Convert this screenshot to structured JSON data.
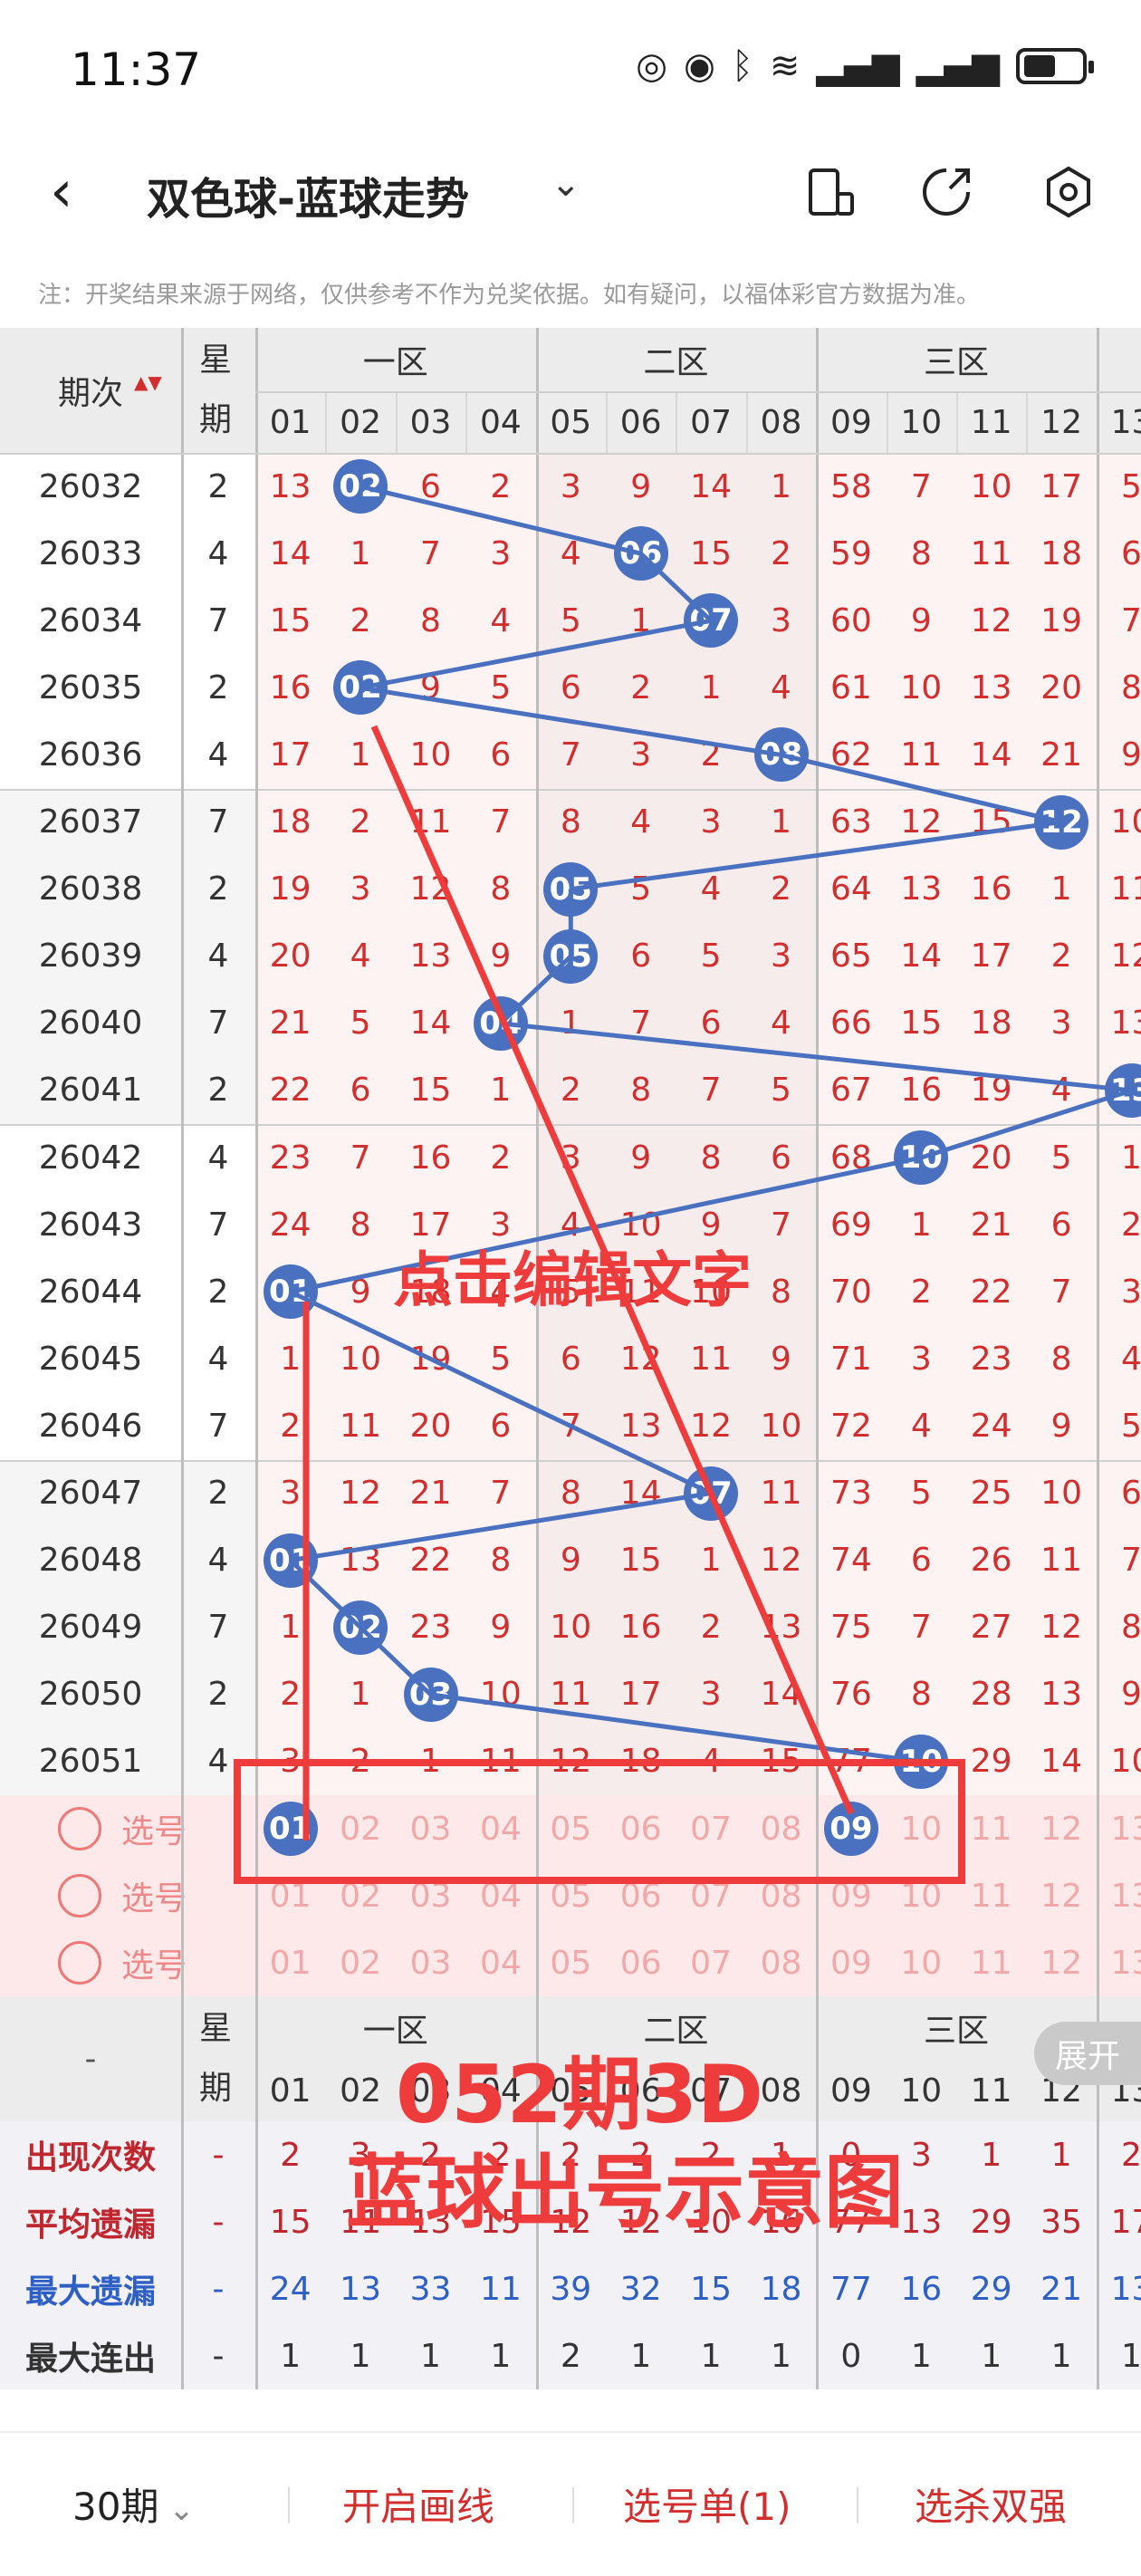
{
  "status": {
    "time": "11:37"
  },
  "header": {
    "title": "双色球-蓝球走势"
  },
  "notice": "注：开奖结果来源于网络，仅供参考不作为兑奖依据。如有疑问，以福体彩官方数据为准。",
  "table": {
    "col_issue": "期次",
    "col_week": "星期",
    "zones": [
      "一区",
      "二区",
      "三区"
    ],
    "cols": [
      "01",
      "02",
      "03",
      "04",
      "05",
      "06",
      "07",
      "08",
      "09",
      "10",
      "11",
      "12",
      "13"
    ],
    "rows": [
      {
        "issue": "26032",
        "week": "2",
        "vals": [
          "13",
          "02",
          "6",
          "2",
          "3",
          "9",
          "14",
          "1",
          "58",
          "7",
          "10",
          "17",
          "5"
        ],
        "hit": 1
      },
      {
        "issue": "26033",
        "week": "4",
        "vals": [
          "14",
          "1",
          "7",
          "3",
          "4",
          "06",
          "15",
          "2",
          "59",
          "8",
          "11",
          "18",
          "6"
        ],
        "hit": 5
      },
      {
        "issue": "26034",
        "week": "7",
        "vals": [
          "15",
          "2",
          "8",
          "4",
          "5",
          "1",
          "07",
          "3",
          "60",
          "9",
          "12",
          "19",
          "7"
        ],
        "hit": 6
      },
      {
        "issue": "26035",
        "week": "2",
        "vals": [
          "16",
          "02",
          "9",
          "5",
          "6",
          "2",
          "1",
          "4",
          "61",
          "10",
          "13",
          "20",
          "8"
        ],
        "hit": 1
      },
      {
        "issue": "26036",
        "week": "4",
        "vals": [
          "17",
          "1",
          "10",
          "6",
          "7",
          "3",
          "2",
          "08",
          "62",
          "11",
          "14",
          "21",
          "9"
        ],
        "hit": 7
      },
      {
        "issue": "26037",
        "week": "7",
        "vals": [
          "18",
          "2",
          "11",
          "7",
          "8",
          "4",
          "3",
          "1",
          "63",
          "12",
          "15",
          "12",
          "10"
        ],
        "hit": 11
      },
      {
        "issue": "26038",
        "week": "2",
        "vals": [
          "19",
          "3",
          "12",
          "8",
          "05",
          "5",
          "4",
          "2",
          "64",
          "13",
          "16",
          "1",
          "11"
        ],
        "hit": 4
      },
      {
        "issue": "26039",
        "week": "4",
        "vals": [
          "20",
          "4",
          "13",
          "9",
          "05",
          "6",
          "5",
          "3",
          "65",
          "14",
          "17",
          "2",
          "12"
        ],
        "hit": 4
      },
      {
        "issue": "26040",
        "week": "7",
        "vals": [
          "21",
          "5",
          "14",
          "04",
          "1",
          "7",
          "6",
          "4",
          "66",
          "15",
          "18",
          "3",
          "13"
        ],
        "hit": 3
      },
      {
        "issue": "26041",
        "week": "2",
        "vals": [
          "22",
          "6",
          "15",
          "1",
          "2",
          "8",
          "7",
          "5",
          "67",
          "16",
          "19",
          "4",
          "13"
        ],
        "hit": 12
      },
      {
        "issue": "26042",
        "week": "4",
        "vals": [
          "23",
          "7",
          "16",
          "2",
          "3",
          "9",
          "8",
          "6",
          "68",
          "10",
          "20",
          "5",
          "1"
        ],
        "hit": 9
      },
      {
        "issue": "26043",
        "week": "7",
        "vals": [
          "24",
          "8",
          "17",
          "3",
          "4",
          "10",
          "9",
          "7",
          "69",
          "1",
          "21",
          "6",
          "2"
        ],
        "hit": -1
      },
      {
        "issue": "26044",
        "week": "2",
        "vals": [
          "01",
          "9",
          "18",
          "4",
          "5",
          "11",
          "10",
          "8",
          "70",
          "2",
          "22",
          "7",
          "3"
        ],
        "hit": 0
      },
      {
        "issue": "26045",
        "week": "4",
        "vals": [
          "1",
          "10",
          "19",
          "5",
          "6",
          "12",
          "11",
          "9",
          "71",
          "3",
          "23",
          "8",
          "4"
        ],
        "hit": -1
      },
      {
        "issue": "26046",
        "week": "7",
        "vals": [
          "2",
          "11",
          "20",
          "6",
          "7",
          "13",
          "12",
          "10",
          "72",
          "4",
          "24",
          "9",
          "5"
        ],
        "hit": -1
      },
      {
        "issue": "26047",
        "week": "2",
        "vals": [
          "3",
          "12",
          "21",
          "7",
          "8",
          "14",
          "07",
          "11",
          "73",
          "5",
          "25",
          "10",
          "6"
        ],
        "hit": 6
      },
      {
        "issue": "26048",
        "week": "4",
        "vals": [
          "01",
          "13",
          "22",
          "8",
          "9",
          "15",
          "1",
          "12",
          "74",
          "6",
          "26",
          "11",
          "7"
        ],
        "hit": 0
      },
      {
        "issue": "26049",
        "week": "7",
        "vals": [
          "1",
          "02",
          "23",
          "9",
          "10",
          "16",
          "2",
          "13",
          "75",
          "7",
          "27",
          "12",
          "8"
        ],
        "hit": 1
      },
      {
        "issue": "26050",
        "week": "2",
        "vals": [
          "2",
          "1",
          "03",
          "10",
          "11",
          "17",
          "3",
          "14",
          "76",
          "8",
          "28",
          "13",
          "9"
        ],
        "hit": 2
      },
      {
        "issue": "26051",
        "week": "4",
        "vals": [
          "3",
          "2",
          "1",
          "11",
          "12",
          "18",
          "4",
          "15",
          "77",
          "10",
          "29",
          "14",
          "10"
        ],
        "hit": 9
      }
    ],
    "pick_label": "选号",
    "pick_rows": 3,
    "pick_selected": [
      0,
      8
    ],
    "stats": [
      {
        "label": "出现次数",
        "week": "-",
        "vals": [
          "2",
          "3",
          "2",
          "2",
          "2",
          "2",
          "2",
          "1",
          "0",
          "3",
          "1",
          "1",
          "2"
        ],
        "color": "#c0262e"
      },
      {
        "label": "平均遗漏",
        "week": "-",
        "vals": [
          "15",
          "11",
          "13",
          "15",
          "12",
          "12",
          "10",
          "16",
          "77",
          "13",
          "29",
          "35",
          "17"
        ],
        "color": "#c0262e"
      },
      {
        "label": "最大遗漏",
        "week": "-",
        "vals": [
          "24",
          "13",
          "33",
          "11",
          "39",
          "32",
          "15",
          "18",
          "77",
          "16",
          "29",
          "21",
          "13"
        ],
        "color": "#2d5fc4"
      },
      {
        "label": "最大连出",
        "week": "-",
        "vals": [
          "1",
          "1",
          "1",
          "1",
          "2",
          "1",
          "1",
          "1",
          "0",
          "1",
          "1",
          "1",
          "1"
        ],
        "color": "#333"
      }
    ],
    "dash": "-",
    "expand": "展开"
  },
  "annotations": {
    "edit_text": "点击编辑文字",
    "big_line1": "052期3D",
    "big_line2": "蓝球出号示意图"
  },
  "bottom": {
    "periods": "30期",
    "draw_line": "开启画线",
    "pick_list": "选号单(1)",
    "kill": "选杀双强"
  },
  "colors": {
    "ball": "#4a70c0",
    "red": "#d22e2e",
    "annot": "#ee3b3b"
  }
}
